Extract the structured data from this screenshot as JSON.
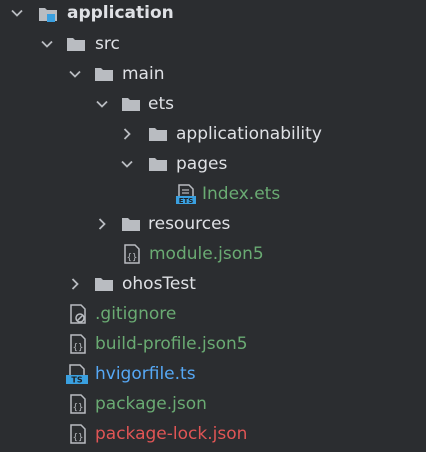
{
  "colors": {
    "background": "#2b2d30",
    "folder": "#b9bcc1",
    "text": "#dfe1e5",
    "git_added": "#6aab73",
    "git_modified": "#56a8f5",
    "git_conflict": "#e05555",
    "module_marker": "#3aa0e0"
  },
  "tree": {
    "root": {
      "label": "application",
      "state": "expanded",
      "icon": "module-folder-icon"
    },
    "src": {
      "label": "src",
      "state": "expanded",
      "icon": "folder-icon"
    },
    "main": {
      "label": "main",
      "state": "expanded",
      "icon": "folder-icon"
    },
    "ets": {
      "label": "ets",
      "state": "expanded",
      "icon": "folder-icon"
    },
    "applicationability": {
      "label": "applicationability",
      "state": "collapsed",
      "icon": "folder-icon"
    },
    "pages": {
      "label": "pages",
      "state": "expanded",
      "icon": "folder-icon"
    },
    "index_ets": {
      "label": "Index.ets",
      "icon": "ets-file-icon",
      "status": "added"
    },
    "resources": {
      "label": "resources",
      "state": "collapsed",
      "icon": "folder-icon"
    },
    "module_json5": {
      "label": "module.json5",
      "icon": "json-file-icon",
      "status": "added"
    },
    "ohostest": {
      "label": "ohosTest",
      "state": "collapsed",
      "icon": "folder-icon"
    },
    "gitignore": {
      "label": ".gitignore",
      "icon": "gitignore-file-icon",
      "status": "added"
    },
    "build_profile": {
      "label": "build-profile.json5",
      "icon": "json-file-icon",
      "status": "added"
    },
    "hvigorfile": {
      "label": "hvigorfile.ts",
      "icon": "ts-file-icon",
      "status": "modified",
      "icon_text": "TS"
    },
    "package_json": {
      "label": "package.json",
      "icon": "json-file-icon",
      "status": "added"
    },
    "package_lock": {
      "label": "package-lock.json",
      "icon": "json-file-icon",
      "status": "conflict"
    }
  }
}
